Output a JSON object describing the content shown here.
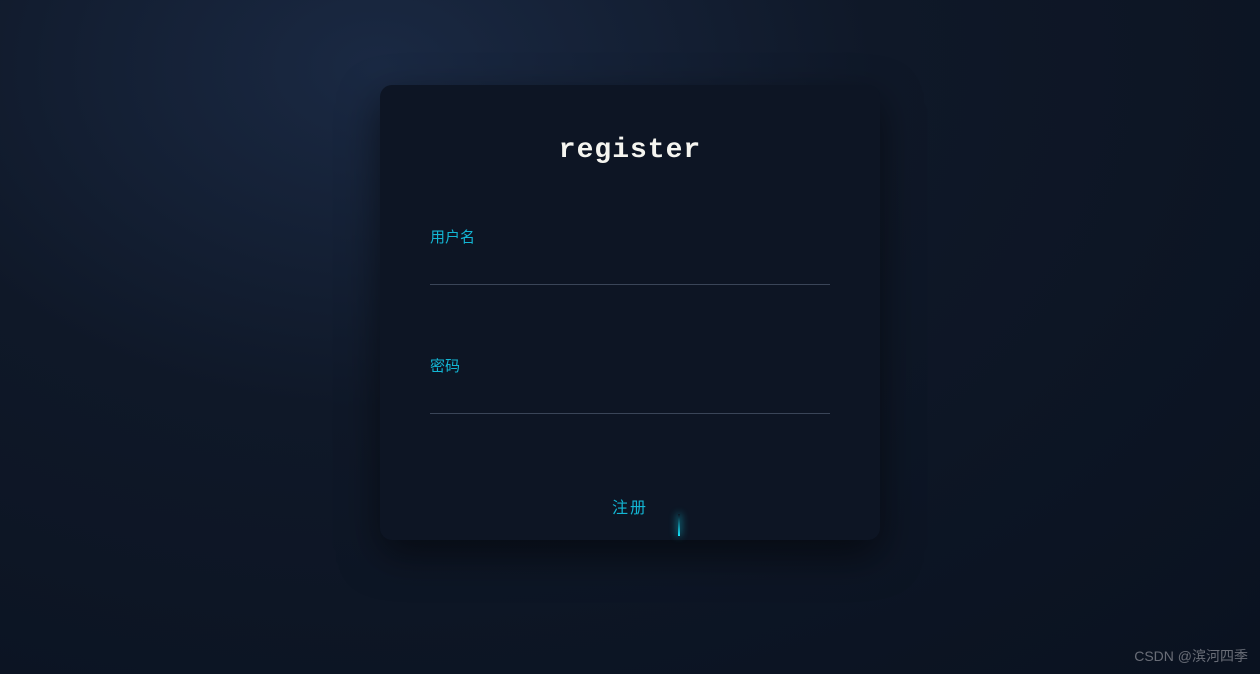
{
  "form": {
    "title": "register",
    "username": {
      "label": "用户名",
      "value": ""
    },
    "password": {
      "label": "密码",
      "value": ""
    },
    "submit_label": "注册"
  },
  "watermark": "CSDN @滨河四季",
  "colors": {
    "accent": "#13b6d4",
    "card_bg": "#0d1524",
    "title_text": "#f5f5f0"
  }
}
